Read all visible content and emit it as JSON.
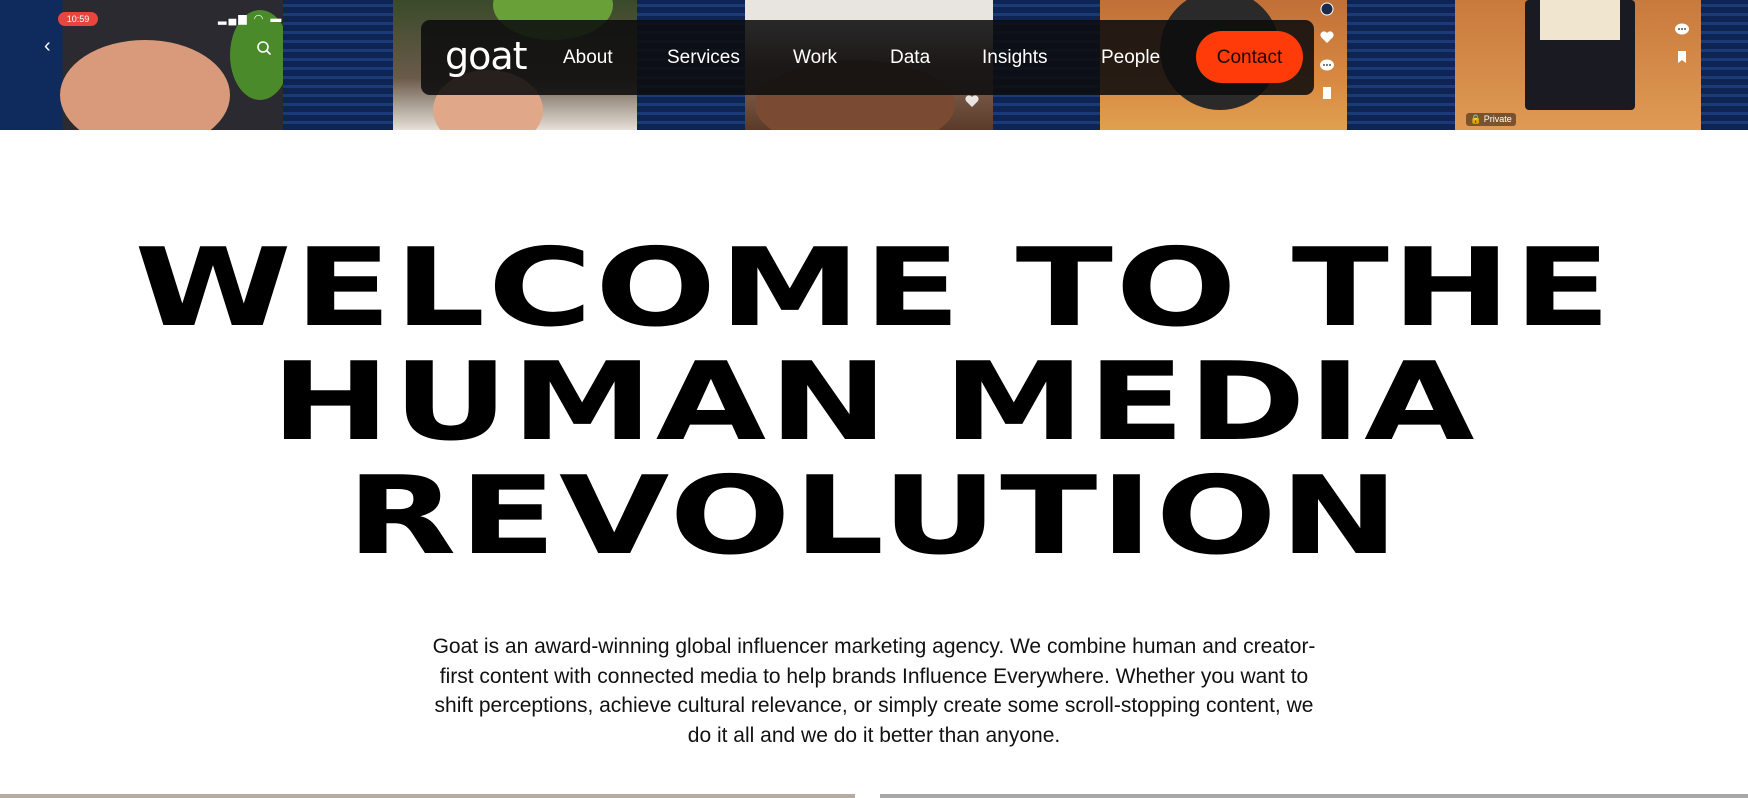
{
  "hero_strip": {
    "status_time": "10:59",
    "private_label": "Private"
  },
  "nav": {
    "logo": "goat",
    "links": [
      {
        "label": "About"
      },
      {
        "label": "Services"
      },
      {
        "label": "Work"
      },
      {
        "label": "Data"
      },
      {
        "label": "Insights"
      },
      {
        "label": "People"
      }
    ],
    "contact_label": "Contact"
  },
  "headline": {
    "line1": "WELCOME TO THE",
    "line2": "HUMAN MEDIA",
    "line3": "REVOLUTION"
  },
  "intro": {
    "text": "Goat is an award-winning global influencer marketing agency. We combine human and creator-first content with connected media to help brands Influence Everywhere. Whether you want to shift perceptions, achieve cultural relevance, or simply create some scroll-stopping content, we do it all and we do it better than anyone."
  },
  "colors": {
    "contact_button": "#ff3b0a",
    "nav_background": "#0c0c0e",
    "headline_text": "#000000"
  },
  "icons": [
    "back-icon",
    "search-icon",
    "heart-icon",
    "comment-icon",
    "bookmark-icon",
    "lock-icon"
  ]
}
